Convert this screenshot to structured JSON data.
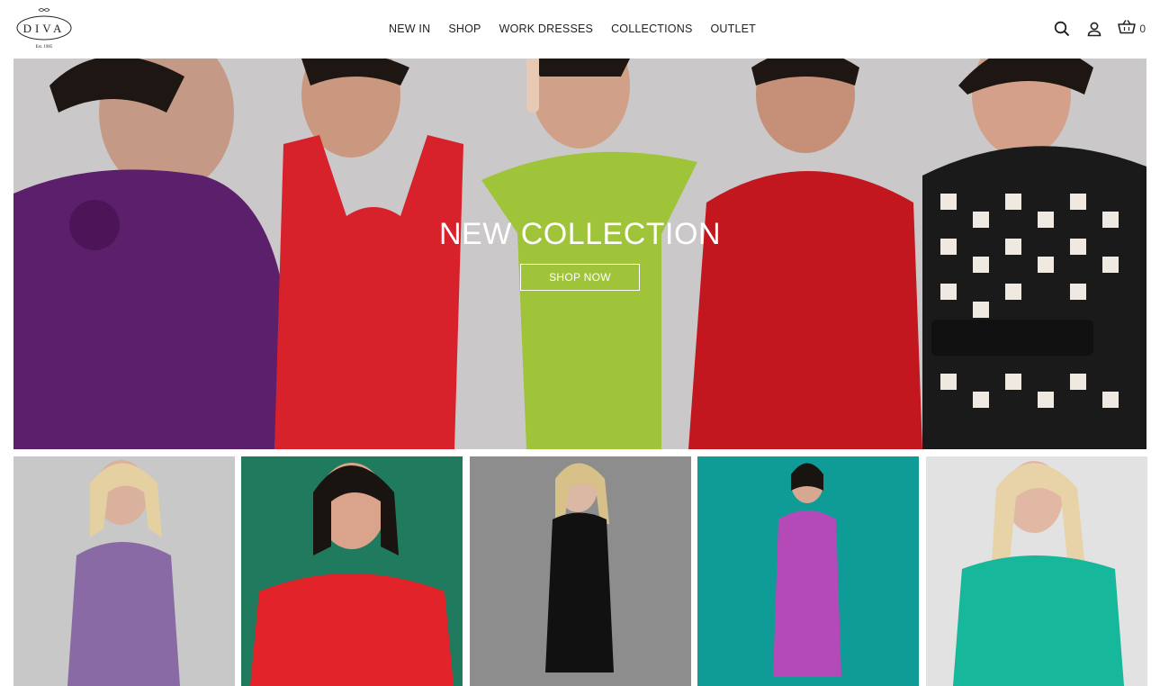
{
  "brand": {
    "logo_text": "DIVA",
    "logo_sub": "Est. 1985"
  },
  "nav": {
    "items": [
      {
        "label": "NEW IN"
      },
      {
        "label": "SHOP"
      },
      {
        "label": "WORK DRESSES"
      },
      {
        "label": "COLLECTIONS"
      },
      {
        "label": "OUTLET"
      }
    ]
  },
  "header_icons": {
    "search": "search-icon",
    "account": "user-icon",
    "cart": "basket-icon",
    "cart_count": "0"
  },
  "hero": {
    "title": "NEW COLLECTION",
    "cta_label": "SHOP NOW",
    "dress_colors": [
      "#5c1f6b",
      "#d8222b",
      "#9fc43a",
      "#c3171f",
      "#1a1a1a"
    ]
  },
  "products": [
    {
      "dress_color": "#8a6aa5",
      "bg_color": "#c8c8c8"
    },
    {
      "dress_color": "#e3232a",
      "bg_color": "#1f7a5e"
    },
    {
      "dress_color": "#111111",
      "bg_color": "#8d8d8d"
    },
    {
      "dress_color": "#b449b8",
      "bg_color": "#0f9c96"
    },
    {
      "dress_color": "#16b79a",
      "bg_color": "#e2e2e2"
    }
  ]
}
